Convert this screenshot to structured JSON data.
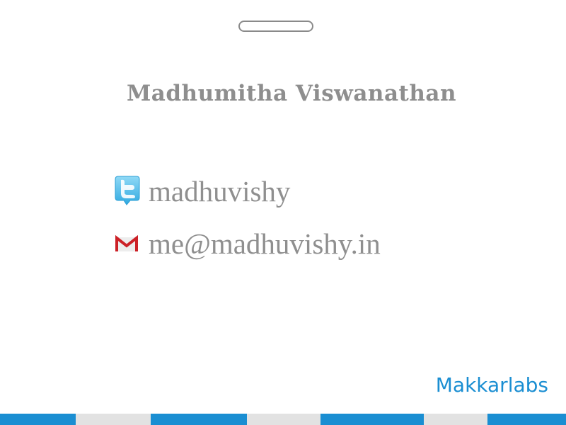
{
  "card": {
    "name": "Madhumitha Viswanathan",
    "twitter": {
      "icon": "twitter-bird-icon",
      "handle": "madhuvishy"
    },
    "email": {
      "icon": "gmail-icon",
      "address": "me@madhuvishy.in"
    },
    "brand": "Makkarlabs"
  },
  "colors": {
    "accent_blue": "#1a8ed2",
    "stripe_gray": "#e2e2e2",
    "text_gray": "#8e8e8e",
    "gmail_red": "#cc2127"
  }
}
